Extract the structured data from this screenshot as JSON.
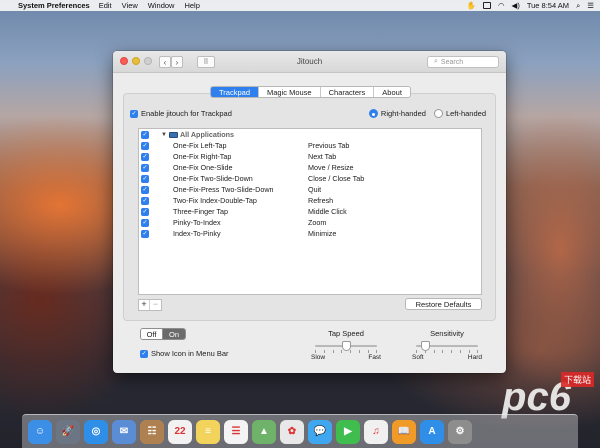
{
  "menubar": {
    "apple": "",
    "app": "System Preferences",
    "menus": [
      "Edit",
      "View",
      "Window",
      "Help"
    ],
    "time": "Tue 8:54 AM"
  },
  "window": {
    "title": "Jitouch",
    "search_placeholder": "Search",
    "back": "‹",
    "forward": "›",
    "grid": "⠿"
  },
  "tabs": [
    {
      "label": "Trackpad",
      "active": true
    },
    {
      "label": "Magic Mouse",
      "active": false
    },
    {
      "label": "Characters",
      "active": false
    },
    {
      "label": "About",
      "active": false
    }
  ],
  "trackpad": {
    "enable_label": "Enable jitouch for Trackpad",
    "right_handed": "Right-handed",
    "left_handed": "Left-handed",
    "handedness": "right",
    "group_label": "All Applications",
    "gestures": [
      {
        "name": "One-Fix Left-Tap",
        "action": "Previous Tab"
      },
      {
        "name": "One-Fix Right-Tap",
        "action": "Next Tab"
      },
      {
        "name": "One-Fix One-Slide",
        "action": "Move / Resize"
      },
      {
        "name": "One-Fix Two-Slide-Down",
        "action": "Close / Close Tab"
      },
      {
        "name": "One-Fix-Press Two-Slide-Down",
        "action": "Quit"
      },
      {
        "name": "Two-Fix Index-Double-Tap",
        "action": "Refresh"
      },
      {
        "name": "Three-Finger Tap",
        "action": "Middle Click"
      },
      {
        "name": "Pinky-To-Index",
        "action": "Zoom"
      },
      {
        "name": "Index-To-Pinky",
        "action": "Minimize"
      }
    ],
    "add": "+",
    "remove": "−",
    "restore": "Restore Defaults"
  },
  "footer": {
    "off": "Off",
    "on": "On",
    "state": "on",
    "show_icon_label": "Show Icon in Menu Bar",
    "tap_speed": {
      "label": "Tap Speed",
      "min": "Slow",
      "max": "Fast",
      "value": 0.5
    },
    "sensitivity": {
      "label": "Sensitivity",
      "min": "Soft",
      "max": "Hard",
      "value": 0.15
    }
  },
  "watermark": {
    "big": "pc6",
    "box": "下载站"
  },
  "dock_icons": [
    {
      "name": "finder",
      "color": "#3b8fe6",
      "glyph": "☺"
    },
    {
      "name": "launchpad",
      "color": "#6c7583",
      "glyph": "🚀"
    },
    {
      "name": "safari",
      "color": "#2f8fe8",
      "glyph": "◎"
    },
    {
      "name": "mail",
      "color": "#5b8cd6",
      "glyph": "✉"
    },
    {
      "name": "contacts",
      "color": "#b08150",
      "glyph": "☷"
    },
    {
      "name": "calendar",
      "color": "#f2f2f2",
      "glyph": "22"
    },
    {
      "name": "notes",
      "color": "#f2d45c",
      "glyph": "≡"
    },
    {
      "name": "reminders",
      "color": "#f4f4f4",
      "glyph": "☰"
    },
    {
      "name": "maps",
      "color": "#6fb36a",
      "glyph": "▲"
    },
    {
      "name": "photos",
      "color": "#e8e8e8",
      "glyph": "✿"
    },
    {
      "name": "messages",
      "color": "#3fa7f0",
      "glyph": "💬"
    },
    {
      "name": "facetime",
      "color": "#3fbd4e",
      "glyph": "▶"
    },
    {
      "name": "itunes",
      "color": "#f0f0f0",
      "glyph": "♫"
    },
    {
      "name": "ibooks",
      "color": "#f09a28",
      "glyph": "📖"
    },
    {
      "name": "app-store",
      "color": "#2f8fe8",
      "glyph": "A"
    },
    {
      "name": "system-preferences",
      "color": "#8d8d8d",
      "glyph": "⚙"
    }
  ]
}
